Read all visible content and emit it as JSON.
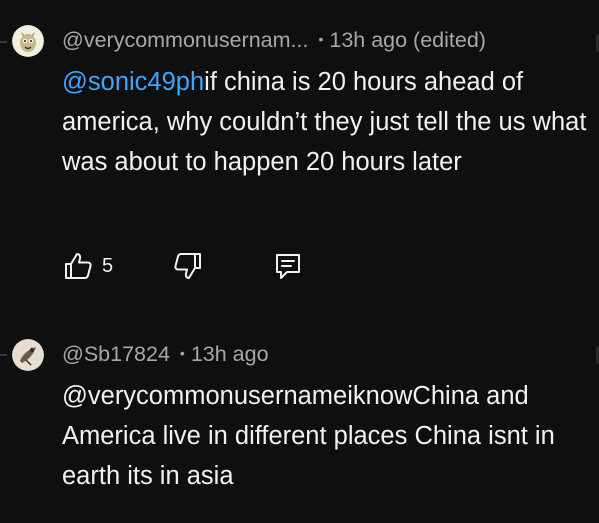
{
  "comments": [
    {
      "username": "@verycommonusernam...",
      "separator": "•",
      "time": "13h ago (edited)",
      "mention": "@sonic49ph",
      "text": "if china is 20 hours ahead of america, why couldn’t they just tell the us what was about to happen 20 hours later",
      "likes": "5"
    },
    {
      "username": "@Sb17824",
      "separator": "•",
      "time": "13h ago",
      "text": "@verycommonusernameiknowChina and America live in different places China isnt in earth its in asia"
    }
  ],
  "icons": {
    "like": "thumbs-up-icon",
    "dislike": "thumbs-down-icon",
    "reply": "comment-reply-icon"
  },
  "colors": {
    "background": "#0f0f0f",
    "text": "#f1f1f1",
    "meta": "#a8a8a8",
    "mention": "#3ea6ff"
  }
}
